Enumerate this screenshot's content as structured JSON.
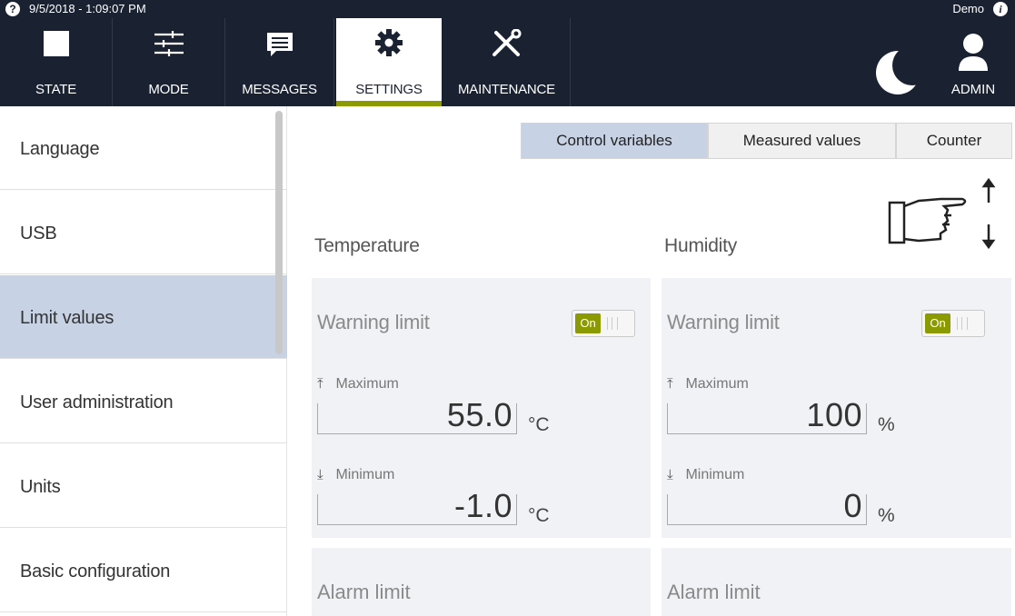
{
  "status": {
    "datetime": "9/5/2018 - 1:09:07 PM",
    "user": "Demo",
    "help_icon": "?",
    "info_icon": "i"
  },
  "nav": {
    "tabs": [
      {
        "label": "STATE",
        "icon": "square-icon"
      },
      {
        "label": "MODE",
        "icon": "sliders-icon"
      },
      {
        "label": "MESSAGES",
        "icon": "message-icon"
      },
      {
        "label": "SETTINGS",
        "icon": "gear-icon"
      },
      {
        "label": "MAINTENANCE",
        "icon": "tools-icon"
      }
    ],
    "active": "SETTINGS",
    "admin_label": "ADMIN"
  },
  "sidebar": {
    "items": [
      {
        "label": "Language"
      },
      {
        "label": "USB"
      },
      {
        "label": "Limit values"
      },
      {
        "label": "User administration"
      },
      {
        "label": "Units"
      },
      {
        "label": "Basic configuration"
      }
    ],
    "selected": "Limit values"
  },
  "segments": {
    "items": [
      "Control variables",
      "Measured values",
      "Counter"
    ],
    "active": "Control variables"
  },
  "temperature": {
    "title": "Temperature",
    "warning": {
      "title": "Warning limit",
      "toggle": "On",
      "max_label": "Maximum",
      "max_value": "55.0",
      "min_label": "Minimum",
      "min_value": "-1.0",
      "unit": "°C"
    },
    "alarm_title": "Alarm limit"
  },
  "humidity": {
    "title": "Humidity",
    "warning": {
      "title": "Warning limit",
      "toggle": "On",
      "max_label": "Maximum",
      "max_value": "100",
      "min_label": "Minimum",
      "min_value": "0",
      "unit": "%"
    },
    "alarm_title": "Alarm limit"
  },
  "colors": {
    "navbar": "#1a2232",
    "accent": "#8a9a00",
    "selected": "#c7d3e4"
  }
}
